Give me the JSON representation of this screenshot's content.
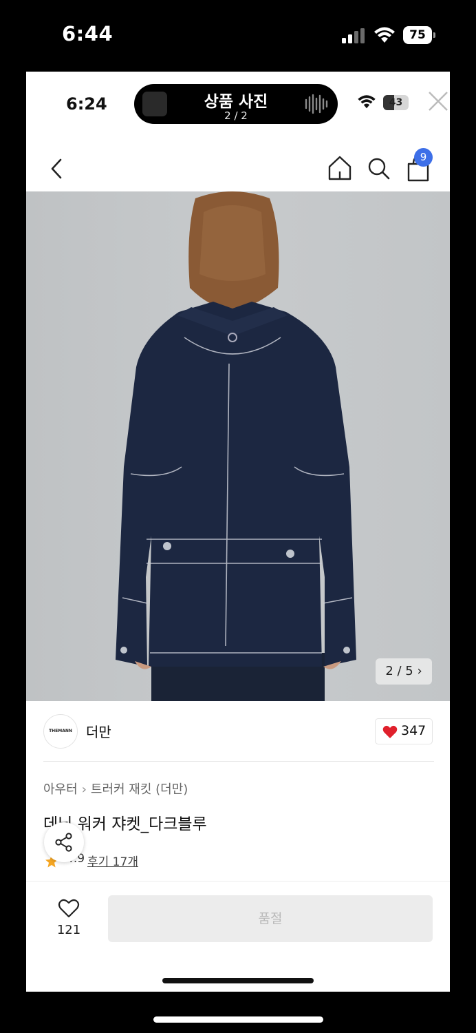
{
  "outer_status": {
    "time": "6:44",
    "battery": "75"
  },
  "inner_status": {
    "time": "6:24",
    "activity_title": "상품 사진",
    "activity_subtitle": "2 / 2",
    "battery": "43"
  },
  "nav": {
    "cart_count": "9"
  },
  "photo": {
    "counter": "2 / 5 ›"
  },
  "brand": {
    "logo_text": "THEMANN",
    "name": "더만",
    "like_count": "347"
  },
  "product": {
    "breadcrumb": [
      "아우터",
      "트러커 재킷 (더만)"
    ],
    "title": "데님 워커 쟈켓_다크블루",
    "rating": "4.9",
    "reviews_label": "후기 17개"
  },
  "bottom": {
    "wish_count": "121",
    "buy_label": "품절"
  },
  "colors": {
    "badge": "#3d6fe8",
    "heart": "#e0202c",
    "star": "#f5a623"
  }
}
